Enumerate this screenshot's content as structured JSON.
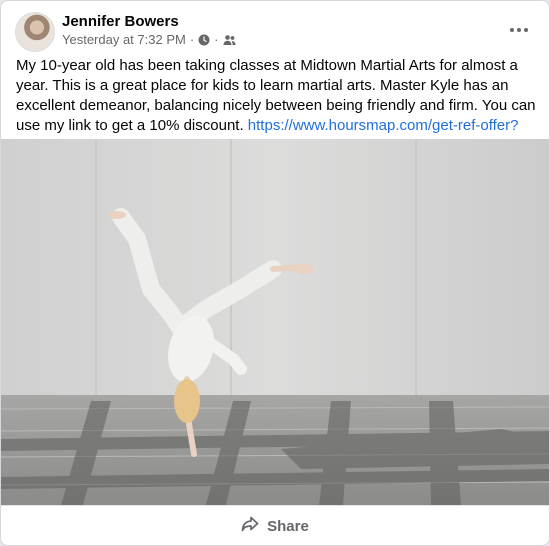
{
  "post": {
    "author": "Jennifer Bowers",
    "timestamp": "Yesterday at 7:32 PM",
    "separator": "·",
    "privacy_icon": "friends-icon",
    "text": "My 10-year old has been taking classes at Midtown Martial Arts for almost a year. This is a great place for kids to learn martial arts. Master Kyle has an excellent demeanor, balancing nicely between being friendly and firm. You can use my link to get a 10% discount.",
    "link": "https://www.hoursmap.com/get-ref-offer?t=f..."
  },
  "actions": {
    "share_label": "Share",
    "share_icon": "share-arrow-icon"
  },
  "colors": {
    "link": "#216fdb",
    "text": "#050505",
    "muted": "#65676b"
  }
}
